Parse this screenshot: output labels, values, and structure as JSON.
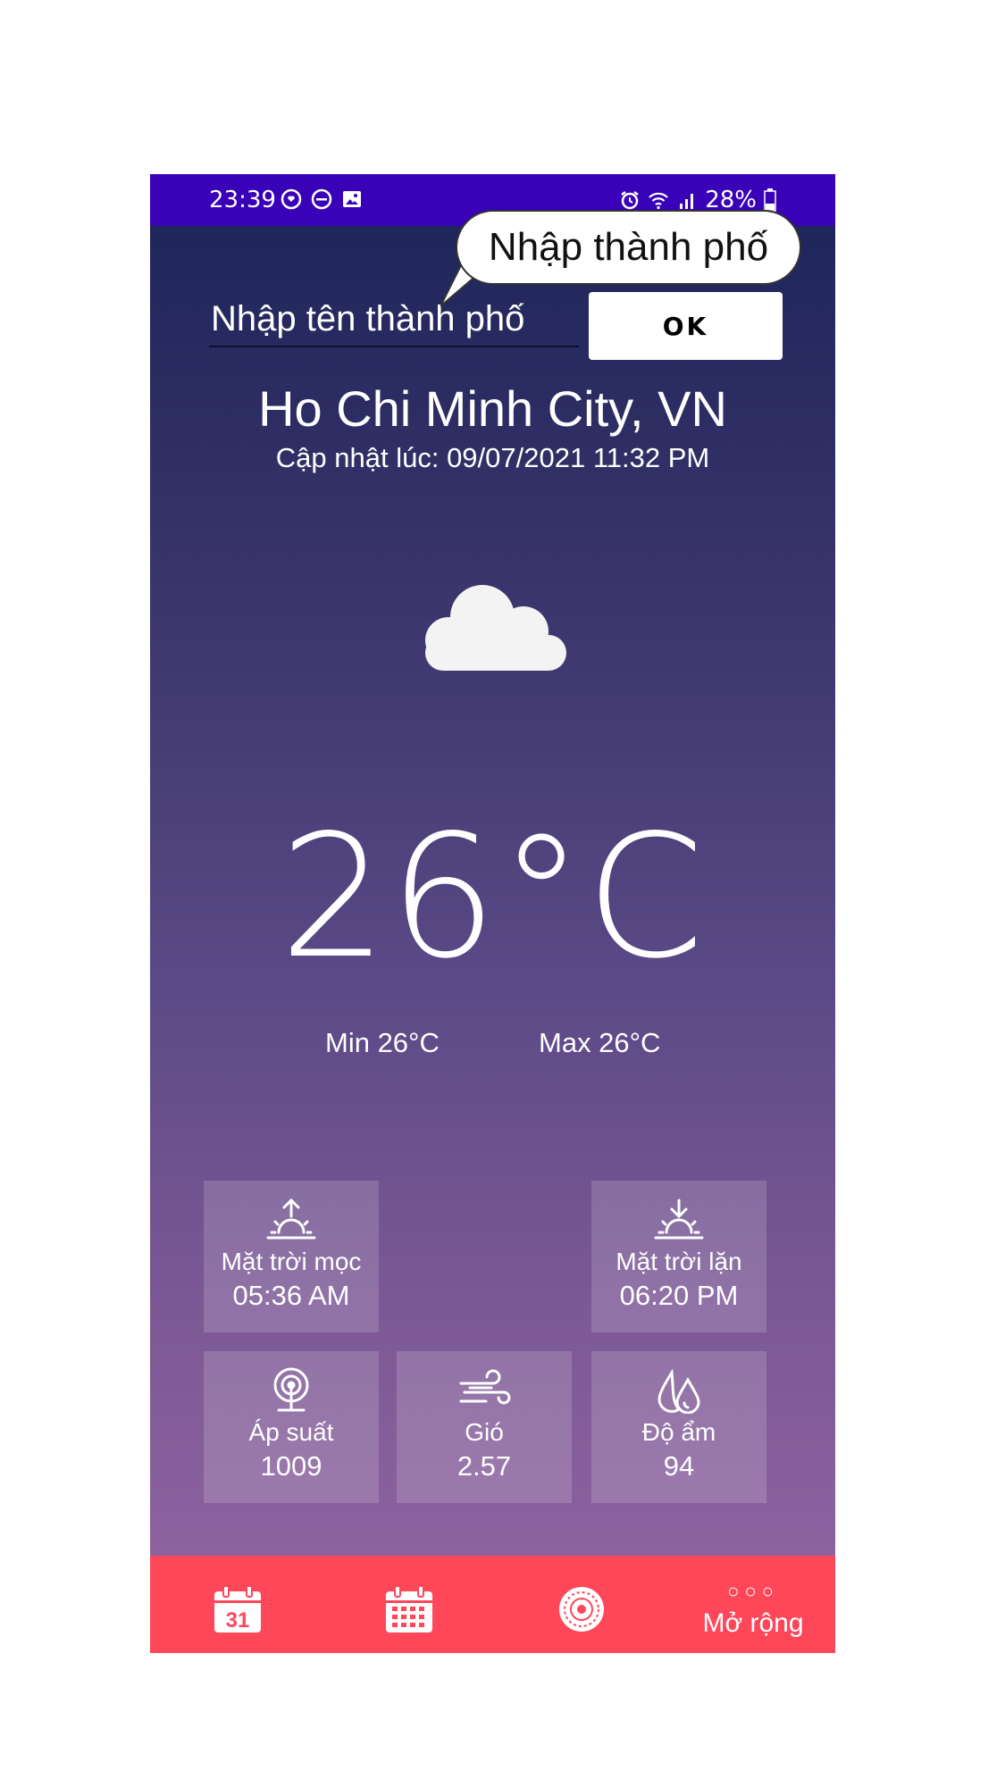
{
  "status_bar": {
    "time": "23:39",
    "battery": "28%"
  },
  "search": {
    "placeholder": "Nhập tên thành phố",
    "ok_label": "OK",
    "tooltip": "Nhập thành phố"
  },
  "weather": {
    "city": "Ho Chi Minh City, VN",
    "updated": "Cập nhật lúc: 09/07/2021 11:32 PM",
    "condition_icon": "cloud-icon",
    "temperature": "26°C",
    "min": "Min 26°C",
    "max": "Max 26°C"
  },
  "tiles": {
    "sunrise": {
      "label": "Mặt trời mọc",
      "value": "05:36 AM",
      "icon": "sunrise-icon"
    },
    "sunset": {
      "label": "Mặt trời lặn",
      "value": "06:20 PM",
      "icon": "sunset-icon"
    },
    "pressure": {
      "label": "Áp suất",
      "value": "1009",
      "icon": "pressure-icon"
    },
    "wind": {
      "label": "Gió",
      "value": "2.57",
      "icon": "wind-icon"
    },
    "humidity": {
      "label": "Độ ẩm",
      "value": "94",
      "icon": "humidity-icon"
    }
  },
  "bottom_nav": {
    "calendar_day": "31",
    "more_label": "Mở rộng",
    "more_dots": "○○○"
  },
  "colors": {
    "status_bar": "#3a02b8",
    "bottom_nav": "#ff475a",
    "gradient_top": "#1b2459",
    "gradient_bottom": "#9366a3"
  }
}
